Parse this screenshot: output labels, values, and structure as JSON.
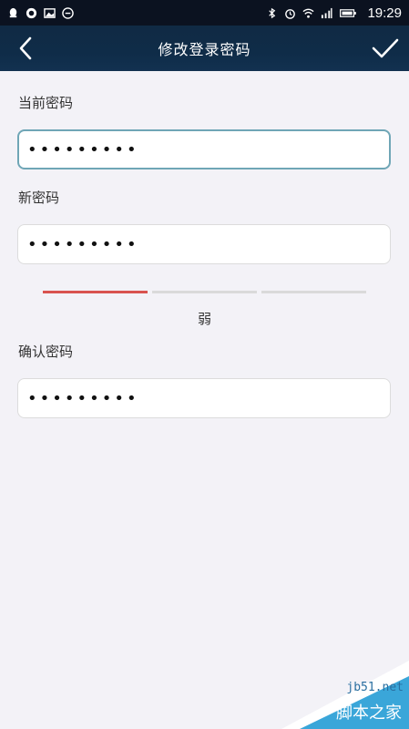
{
  "status_bar": {
    "time": "19:29",
    "left_icons": [
      "qq-icon",
      "app-icon",
      "image-icon",
      "minus-icon"
    ],
    "right_icons": [
      "bluetooth-icon",
      "alarm-icon",
      "wifi-icon",
      "signal-icon",
      "battery-icon"
    ]
  },
  "header": {
    "title": "修改登录密码",
    "back_icon": "chevron-left-icon",
    "confirm_icon": "check-icon"
  },
  "form": {
    "current_label": "当前密码",
    "current_value": "•••••••••",
    "new_label": "新密码",
    "new_value": "•••••••••",
    "strength_level": 1,
    "strength_total": 3,
    "strength_text": "弱",
    "confirm_label": "确认密码",
    "confirm_value": "•••••••••"
  },
  "colors": {
    "header_bg": "#0f2c48",
    "page_bg": "#f3f2f7",
    "focus_border": "#6fa6b6",
    "strength_weak": "#d9534f"
  },
  "watermark": {
    "url": "jb51.net",
    "name": "脚本之家"
  }
}
